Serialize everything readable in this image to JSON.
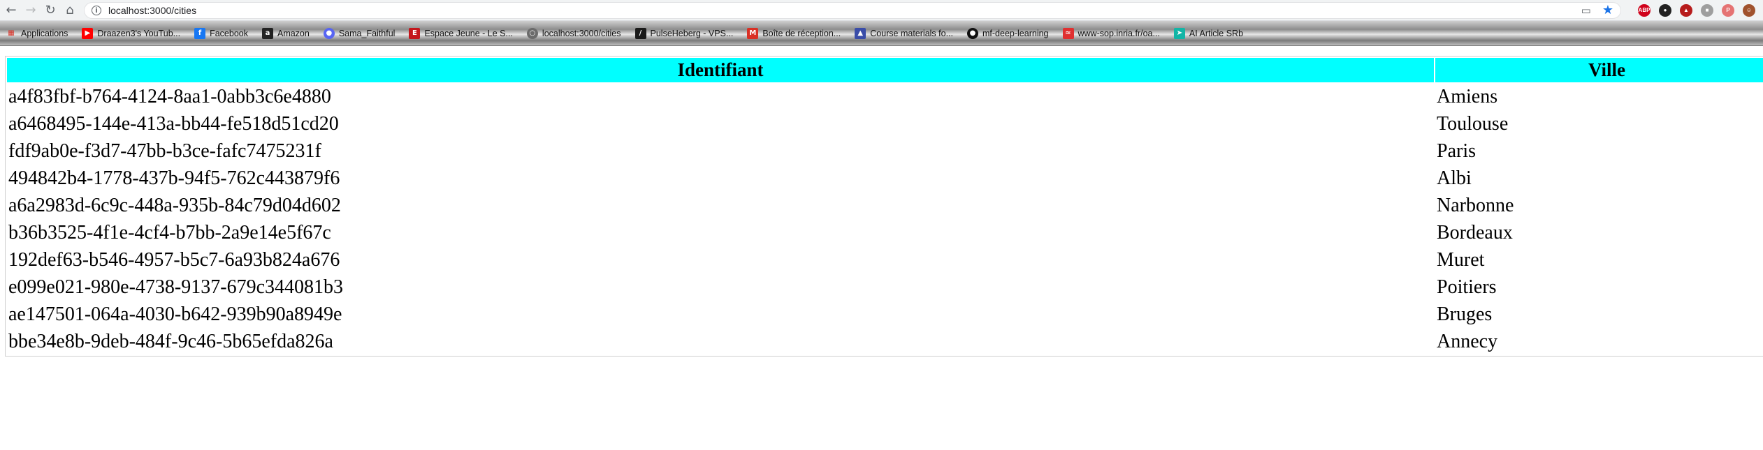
{
  "browser": {
    "back_icon": "arrow-back-icon",
    "forward_icon": "arrow-forward-icon",
    "reload_icon": "reload-icon",
    "home_icon": "home-icon",
    "url": "localhost:3000/cities",
    "extensions": [
      "abp",
      "ext-dark",
      "ext-red",
      "ext-gray",
      "ext-pdf",
      "profile"
    ]
  },
  "bookmarks": [
    {
      "label": "Applications",
      "icon": "apps-grid-icon",
      "color": "#5f6368"
    },
    {
      "label": "Draazen3's YouTub...",
      "icon": "youtube-icon",
      "color": "#ff0000"
    },
    {
      "label": "Facebook",
      "icon": "facebook-icon",
      "color": "#1877f2"
    },
    {
      "label": "Amazon",
      "icon": "amazon-icon",
      "color": "#222222"
    },
    {
      "label": "Sama_Faithful",
      "icon": "discord-icon",
      "color": "#5865f2"
    },
    {
      "label": "Espace Jeune - Le S...",
      "icon": "espace-jeune-icon",
      "color": "#c4161c"
    },
    {
      "label": "localhost:3000/cities",
      "icon": "globe-icon",
      "color": "#6b6b6b"
    },
    {
      "label": "PulseHeberg - VPS...",
      "icon": "pulseheberg-icon",
      "color": "#1a1a1a"
    },
    {
      "label": "Boîte de réception...",
      "icon": "gmail-icon",
      "color": "#d93025"
    },
    {
      "label": "Course materials fo...",
      "icon": "course-icon",
      "color": "#3a4da8"
    },
    {
      "label": "mf-deep-learning",
      "icon": "github-icon",
      "color": "#111111"
    },
    {
      "label": "www-sop.inria.fr/oa...",
      "icon": "inria-icon",
      "color": "#e03030"
    },
    {
      "label": "AI Article SRb",
      "icon": "ai-article-icon",
      "color": "#12b5a6"
    }
  ],
  "table": {
    "headers": {
      "id": "Identifiant",
      "city": "Ville"
    },
    "header_color": "#00ffff",
    "rows": [
      {
        "id": "a4f83fbf-b764-4124-8aa1-0abb3c6e4880",
        "city": "Amiens"
      },
      {
        "id": "a6468495-144e-413a-bb44-fe518d51cd20",
        "city": "Toulouse"
      },
      {
        "id": "fdf9ab0e-f3d7-47bb-b3ce-fafc7475231f",
        "city": "Paris"
      },
      {
        "id": "494842b4-1778-437b-94f5-762c443879f6",
        "city": "Albi"
      },
      {
        "id": "a6a2983d-6c9c-448a-935b-84c79d04d602",
        "city": "Narbonne"
      },
      {
        "id": "b36b3525-4f1e-4cf4-b7bb-2a9e14e5f67c",
        "city": "Bordeaux"
      },
      {
        "id": "192def63-b546-4957-b5c7-6a93b824a676",
        "city": "Muret"
      },
      {
        "id": "e099e021-980e-4738-9137-679c344081b3",
        "city": "Poitiers"
      },
      {
        "id": "ae147501-064a-4030-b642-939b90a8949e",
        "city": "Bruges"
      },
      {
        "id": "bbe34e8b-9deb-484f-9c46-5b65efda826a",
        "city": "Annecy"
      }
    ]
  }
}
